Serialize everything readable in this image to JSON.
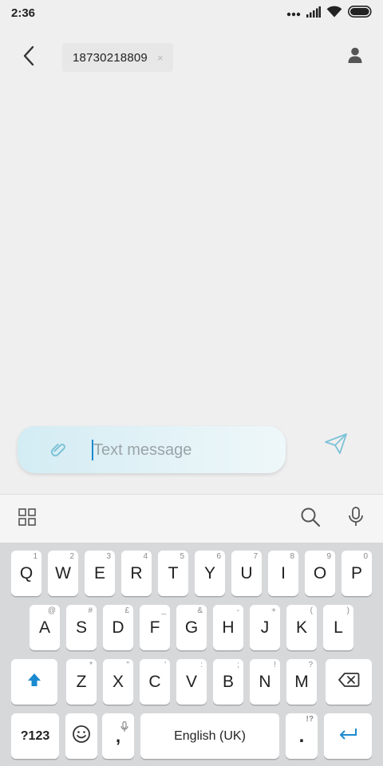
{
  "status_bar": {
    "time": "2:36"
  },
  "header": {
    "back_icon": "chevron-left-icon",
    "recipient_number": "18730218809",
    "chip_remove": "×",
    "contact_icon": "person-icon"
  },
  "compose": {
    "placeholder": "Text message",
    "attach_icon": "paperclip-icon",
    "send_icon": "paper-plane-icon",
    "accent_color": "#1a8ad0"
  },
  "keyboard_toolbar": {
    "left_icon": "grid-icon",
    "search_icon": "search-icon",
    "mic_icon": "microphone-icon"
  },
  "keyboard": {
    "row1": [
      {
        "key": "Q",
        "hint": "1"
      },
      {
        "key": "W",
        "hint": "2"
      },
      {
        "key": "E",
        "hint": "3"
      },
      {
        "key": "R",
        "hint": "4"
      },
      {
        "key": "T",
        "hint": "5"
      },
      {
        "key": "Y",
        "hint": "6"
      },
      {
        "key": "U",
        "hint": "7"
      },
      {
        "key": "I",
        "hint": "8"
      },
      {
        "key": "O",
        "hint": "9"
      },
      {
        "key": "P",
        "hint": "0"
      }
    ],
    "row2": [
      {
        "key": "A",
        "hint": "@"
      },
      {
        "key": "S",
        "hint": "#"
      },
      {
        "key": "D",
        "hint": "£"
      },
      {
        "key": "F",
        "hint": "_"
      },
      {
        "key": "G",
        "hint": "&"
      },
      {
        "key": "H",
        "hint": "-"
      },
      {
        "key": "J",
        "hint": "+"
      },
      {
        "key": "K",
        "hint": "("
      },
      {
        "key": "L",
        "hint": ")"
      }
    ],
    "row3": [
      {
        "key": "Z",
        "hint": "*"
      },
      {
        "key": "X",
        "hint": "\""
      },
      {
        "key": "C",
        "hint": "'"
      },
      {
        "key": "V",
        "hint": ":"
      },
      {
        "key": "B",
        "hint": ";"
      },
      {
        "key": "N",
        "hint": "!"
      },
      {
        "key": "M",
        "hint": "?"
      }
    ],
    "shift_icon": "shift-arrow-icon",
    "backspace_icon": "backspace-icon",
    "symbols_label": "?123",
    "emoji_icon": "smiley-icon",
    "comma_label": ",",
    "space_label": "English (UK)",
    "period_label": ".",
    "period_hint": "!?",
    "enter_icon": "enter-arrow-icon"
  }
}
